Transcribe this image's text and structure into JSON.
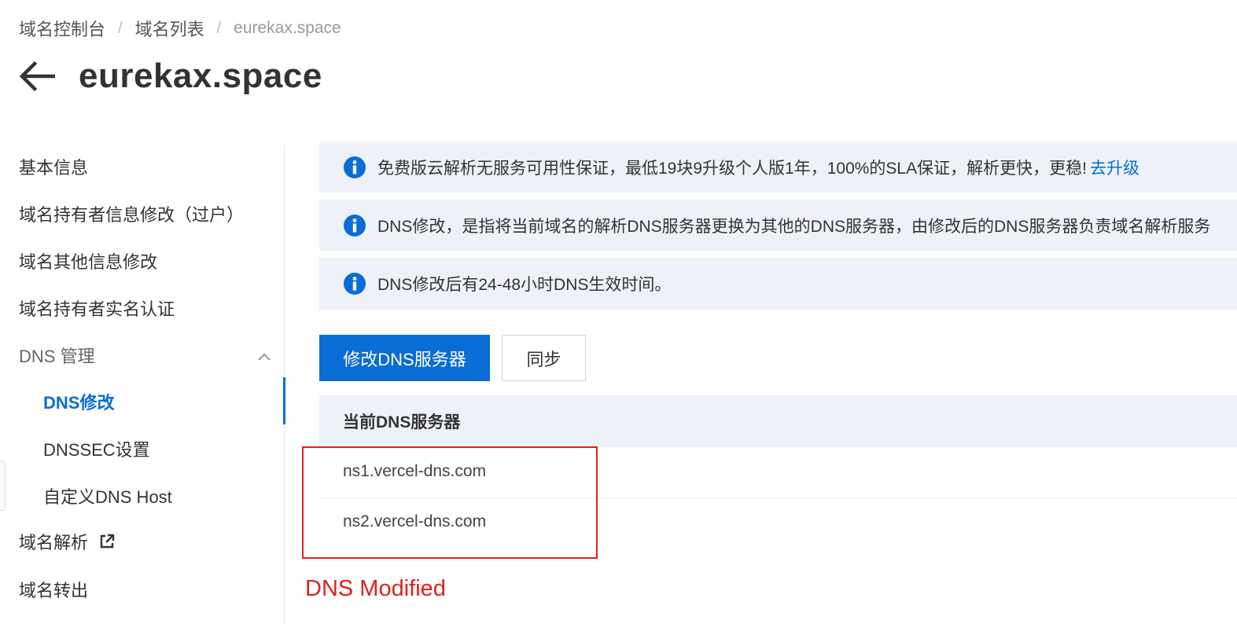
{
  "breadcrumb": {
    "items": [
      "域名控制台",
      "域名列表",
      "eurekax.space"
    ],
    "separator": "/"
  },
  "header": {
    "title": "eurekax.space"
  },
  "sidebar": {
    "items": [
      {
        "label": "基本信息"
      },
      {
        "label": "域名持有者信息修改（过户）"
      },
      {
        "label": "域名其他信息修改"
      },
      {
        "label": "域名持有者实名认证"
      }
    ],
    "dns_group": {
      "label": "DNS 管理",
      "children": [
        {
          "label": "DNS修改",
          "active": true
        },
        {
          "label": "DNSSEC设置"
        },
        {
          "label": "自定义DNS Host"
        }
      ]
    },
    "bottom_items": [
      {
        "label": "域名解析",
        "icon": "external-link-icon"
      },
      {
        "label": "域名转出"
      }
    ]
  },
  "notices": [
    {
      "text": "免费版云解析无服务可用性保证，最低19块9升级个人版1年，100%的SLA保证，解析更快，更稳!",
      "link": "去升级"
    },
    {
      "text": "DNS修改，是指将当前域名的解析DNS服务器更换为其他的DNS服务器，由修改后的DNS服务器负责域名解析服务"
    },
    {
      "text": "DNS修改后有24-48小时DNS生效时间。"
    }
  ],
  "actions": {
    "modify_dns_label": "修改DNS服务器",
    "sync_label": "同步"
  },
  "dns_table": {
    "header": "当前DNS服务器",
    "rows": [
      "ns1.vercel-dns.com",
      "ns2.vercel-dns.com"
    ]
  },
  "annotation": {
    "text": "DNS Modified",
    "color": "#e02020"
  },
  "colors": {
    "accent": "#0a6dd6",
    "notice_bg": "#eef1f7",
    "annotation_red": "#e02020"
  }
}
